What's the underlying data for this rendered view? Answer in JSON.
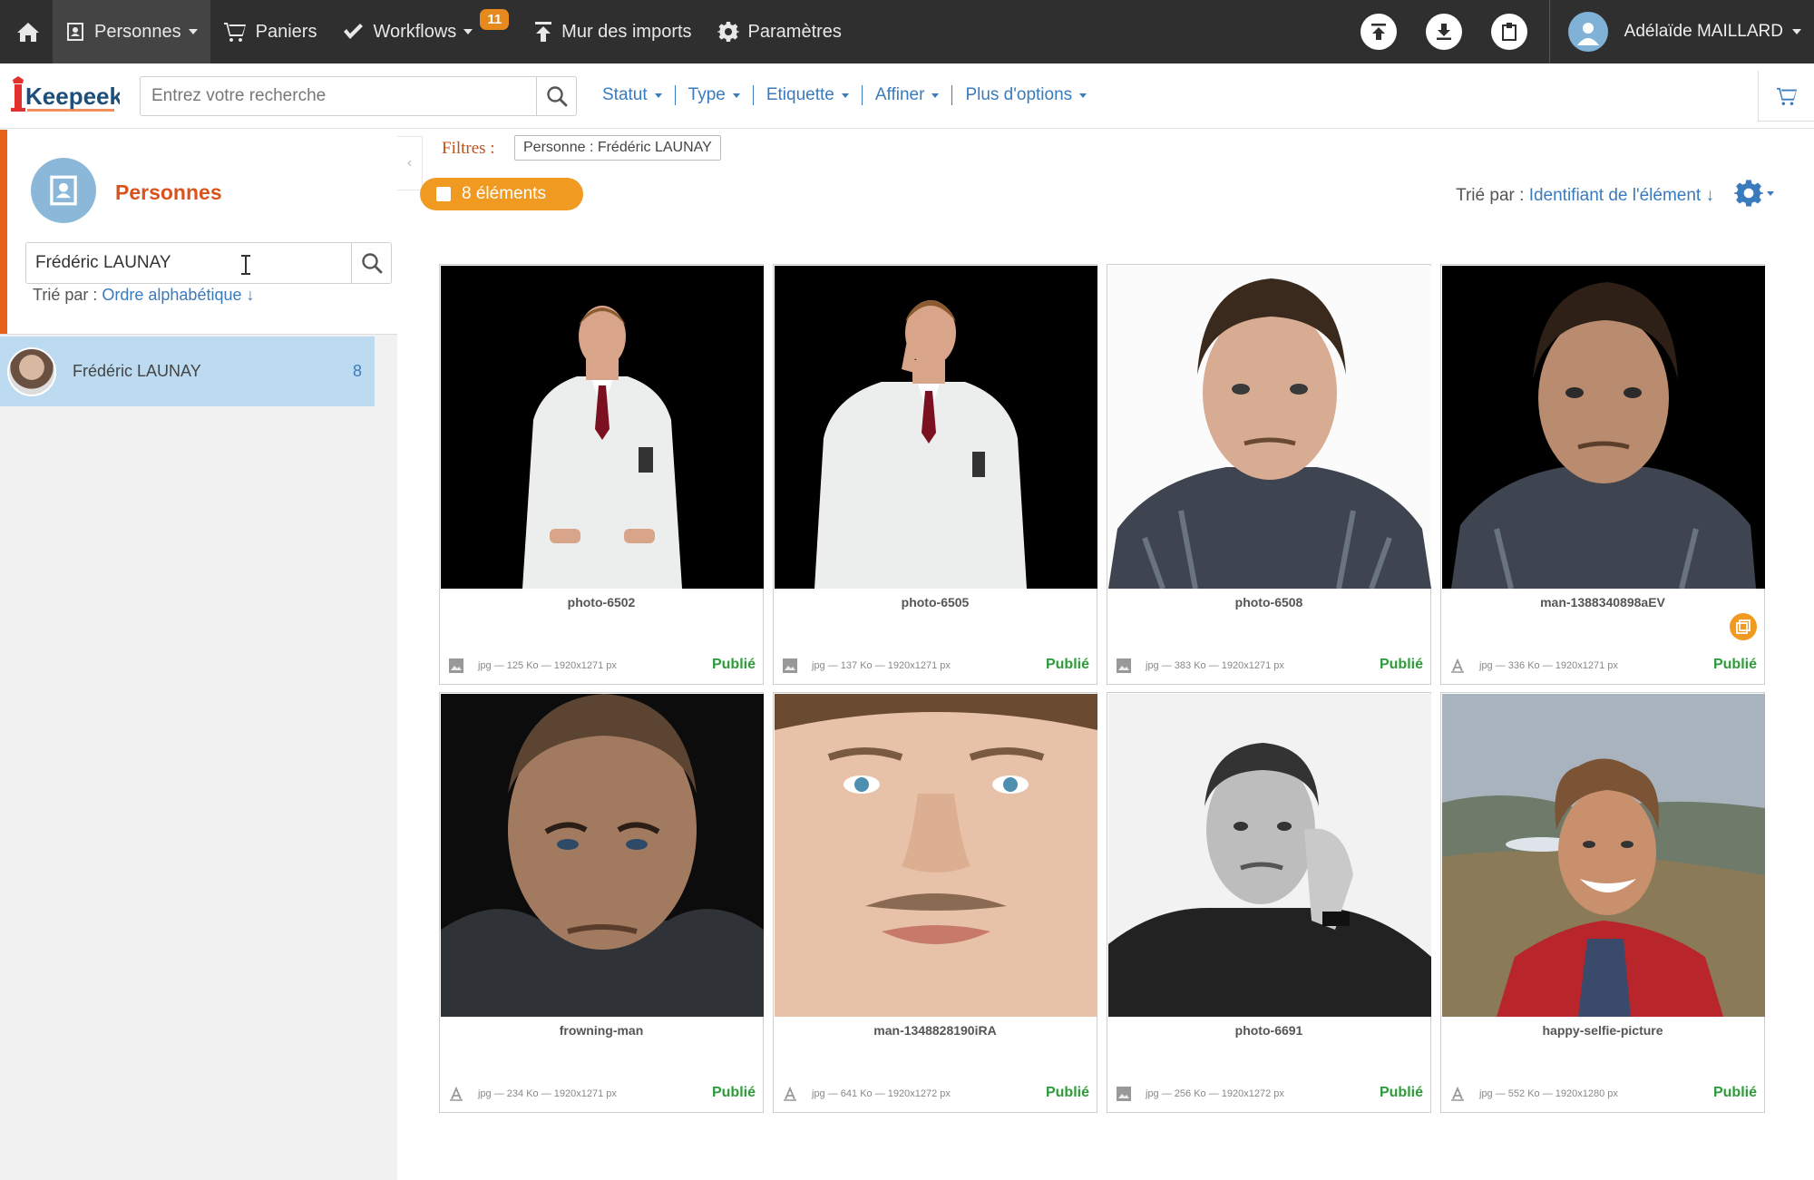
{
  "topnav": {
    "personnes": "Personnes",
    "paniers": "Paniers",
    "workflows": "Workflows",
    "workflows_badge": "11",
    "mur": "Mur des imports",
    "parametres": "Paramètres",
    "user_name": "Adélaïde MAILLARD"
  },
  "search": {
    "placeholder": "Entrez votre recherche",
    "filters": [
      "Statut",
      "Type",
      "Etiquette",
      "Affiner",
      "Plus d'options"
    ]
  },
  "left_panel": {
    "title": "Personnes",
    "search_value": "Frédéric LAUNAY",
    "sort_label": "Trié par :",
    "sort_value": "Ordre alphabétique ↓",
    "person": {
      "name": "Frédéric LAUNAY",
      "count": "8"
    }
  },
  "main": {
    "filters_label": "Filtres :",
    "filter_chip": "Personne : Frédéric LAUNAY",
    "elements_count": "8 éléments",
    "sort_label": "Trié par :",
    "sort_value": "Identifiant de l'élément ↓"
  },
  "cards": [
    {
      "title": "photo-6502",
      "meta": "jpg — 125 Ko — 1920x1271 px",
      "status": "Publié",
      "type_icon": "image-icon"
    },
    {
      "title": "photo-6505",
      "meta": "jpg — 137 Ko — 1920x1271 px",
      "status": "Publié",
      "type_icon": "image-icon"
    },
    {
      "title": "photo-6508",
      "meta": "jpg — 383 Ko — 1920x1271 px",
      "status": "Publié",
      "type_icon": "image-icon"
    },
    {
      "title": "man-1388340898aEV",
      "meta": "jpg — 336 Ko — 1920x1271 px",
      "status": "Publié",
      "type_icon": "text-a-icon"
    },
    {
      "title": "frowning-man",
      "meta": "jpg — 234 Ko — 1920x1271 px",
      "status": "Publié",
      "type_icon": "text-a-icon"
    },
    {
      "title": "man-1348828190iRA",
      "meta": "jpg — 641 Ko — 1920x1272 px",
      "status": "Publié",
      "type_icon": "text-a-icon"
    },
    {
      "title": "photo-6691",
      "meta": "jpg — 256 Ko — 1920x1272 px",
      "status": "Publié",
      "type_icon": "image-icon"
    },
    {
      "title": "happy-selfie-picture",
      "meta": "jpg — 552 Ko — 1920x1280 px",
      "status": "Publié",
      "type_icon": "text-a-icon"
    }
  ],
  "colors": {
    "nav_bg": "#2f2f2f",
    "accent_orange": "#f19a22",
    "title_orange": "#d9531e",
    "link_blue": "#3a7bbd",
    "status_green": "#2e9b3a",
    "selected_row": "#bcdaf0"
  }
}
